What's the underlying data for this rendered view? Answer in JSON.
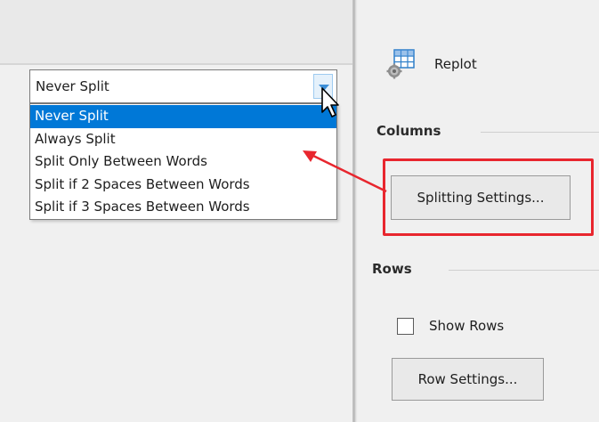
{
  "column_split": {
    "selected_value": "Never Split",
    "options": [
      "Never Split",
      "Always Split",
      "Split Only Between Words",
      "Split if 2 Spaces Between Words",
      "Split if 3 Spaces Between Words"
    ],
    "highlighted_index": 0
  },
  "toolbar": {
    "replot_label": "Replot",
    "replot_icon": "grid-gear-icon"
  },
  "columns": {
    "header": "Columns",
    "splitting_settings_label": "Splitting Settings..."
  },
  "rows": {
    "header": "Rows",
    "show_rows_label": "Show Rows",
    "show_rows_checked": false,
    "row_settings_label": "Row Settings..."
  },
  "colors": {
    "selection": "#0078d7",
    "annotation_red": "#e8262e",
    "dropdown_arrow_bg": "#e5f1fb"
  }
}
